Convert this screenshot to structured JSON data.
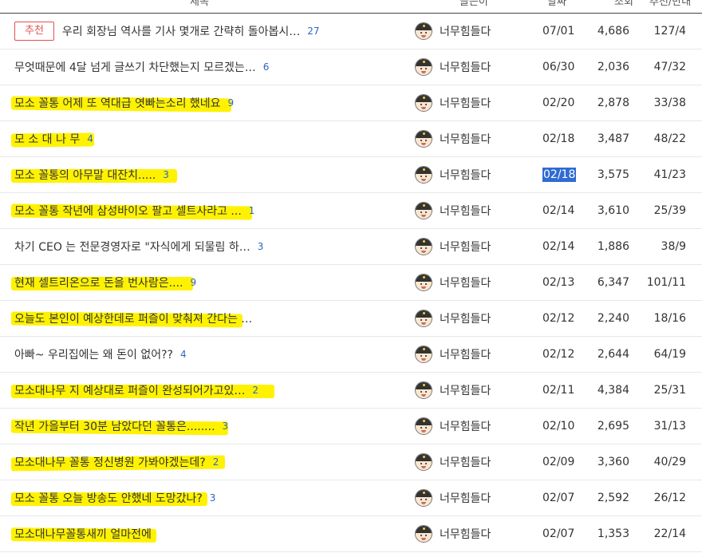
{
  "colors": {
    "highlight": "#fff200",
    "badge": "#e45050",
    "comment_count": "#2d66c3",
    "date_selection": "#2f6bd2"
  },
  "header": {
    "columns": [
      "제목",
      "글쓴이",
      "날짜",
      "조회",
      "추천/반대"
    ]
  },
  "posts": [
    {
      "badge": "추천",
      "title": "우리 회장님 역사를 기사 몇개로 간략히 돌아봅시…",
      "comments": "27",
      "author": "너무힘들다",
      "date": "07/01",
      "views": "4,686",
      "votes": "127/4",
      "highlighted": false,
      "date_selected": false
    },
    {
      "badge": "",
      "title": "무엇때문에 4달 넘게 글쓰기 차단했는지 모르겠는…",
      "comments": "6",
      "author": "너무힘들다",
      "date": "06/30",
      "views": "2,036",
      "votes": "47/32",
      "highlighted": false,
      "date_selected": false
    },
    {
      "badge": "",
      "title": "모소 꼴통 어제 또 역대급 엿빠는소리 했네요",
      "comments": "9",
      "author": "너무힘들다",
      "date": "02/20",
      "views": "2,878",
      "votes": "33/38",
      "highlighted": true,
      "date_selected": false
    },
    {
      "badge": "",
      "title": "모 소 대 나 무",
      "comments": "4",
      "author": "너무힘들다",
      "date": "02/18",
      "views": "3,487",
      "votes": "48/22",
      "highlighted": true,
      "date_selected": false
    },
    {
      "badge": "",
      "title": "모소 꼴통의 아무말 대잔치.....",
      "comments": "3",
      "author": "너무힘들다",
      "date": "02/18",
      "views": "3,575",
      "votes": "41/23",
      "highlighted": true,
      "date_selected": true
    },
    {
      "badge": "",
      "title": "모소 꼴통 작년에 삼성바이오 팔고 셀트사라고 ...",
      "comments": "1",
      "author": "너무힘들다",
      "date": "02/14",
      "views": "3,610",
      "votes": "25/39",
      "highlighted": true,
      "date_selected": false
    },
    {
      "badge": "",
      "title": "차기 CEO 는 전문경영자로 \"자식에게 되물림 하…",
      "comments": "3",
      "author": "너무힘들다",
      "date": "02/14",
      "views": "1,886",
      "votes": "38/9",
      "highlighted": false,
      "date_selected": false
    },
    {
      "badge": "",
      "title": "현재 셀트리온으로 돈을 번사람은....",
      "comments": "9",
      "author": "너무힘들다",
      "date": "02/13",
      "views": "6,347",
      "votes": "101/11",
      "highlighted": true,
      "date_selected": false
    },
    {
      "badge": "",
      "title": "오늘도 본인이 예상한데로 퍼즐이 맞춰져 간다는 …",
      "comments": "",
      "author": "너무힘들다",
      "date": "02/12",
      "views": "2,240",
      "votes": "18/16",
      "highlighted": true,
      "date_selected": false
    },
    {
      "badge": "",
      "title": "아빠~ 우리집에는 왜 돈이 없어??",
      "comments": "4",
      "author": "너무힘들다",
      "date": "02/12",
      "views": "2,644",
      "votes": "64/19",
      "highlighted": false,
      "date_selected": false
    },
    {
      "badge": "",
      "title": "모소대나무 지 예상대로 퍼즐이 완성되어가고있…",
      "comments": "2",
      "author": "너무힘들다",
      "date": "02/11",
      "views": "4,384",
      "votes": "25/31",
      "highlighted": true,
      "date_selected": false
    },
    {
      "badge": "",
      "title": "작년 가을부터 30분 남았다던 꼴통은........",
      "comments": "3",
      "author": "너무힘들다",
      "date": "02/10",
      "views": "2,695",
      "votes": "31/13",
      "highlighted": true,
      "date_selected": false
    },
    {
      "badge": "",
      "title": "모소대나무 꼴통 정신병원 가봐야겠는데?",
      "comments": "2",
      "author": "너무힘들다",
      "date": "02/09",
      "views": "3,360",
      "votes": "40/29",
      "highlighted": true,
      "date_selected": false
    },
    {
      "badge": "",
      "title": "모소 꼴통 오늘 방송도 안했네 도망갔나?",
      "comments": "3",
      "author": "너무힘들다",
      "date": "02/07",
      "views": "2,592",
      "votes": "26/12",
      "highlighted": true,
      "date_selected": false
    },
    {
      "badge": "",
      "title": "모소대나무꼴통새끼 얼마전에",
      "comments": "",
      "author": "너무힘들다",
      "date": "02/07",
      "views": "1,353",
      "votes": "22/14",
      "highlighted": true,
      "date_selected": false
    }
  ]
}
